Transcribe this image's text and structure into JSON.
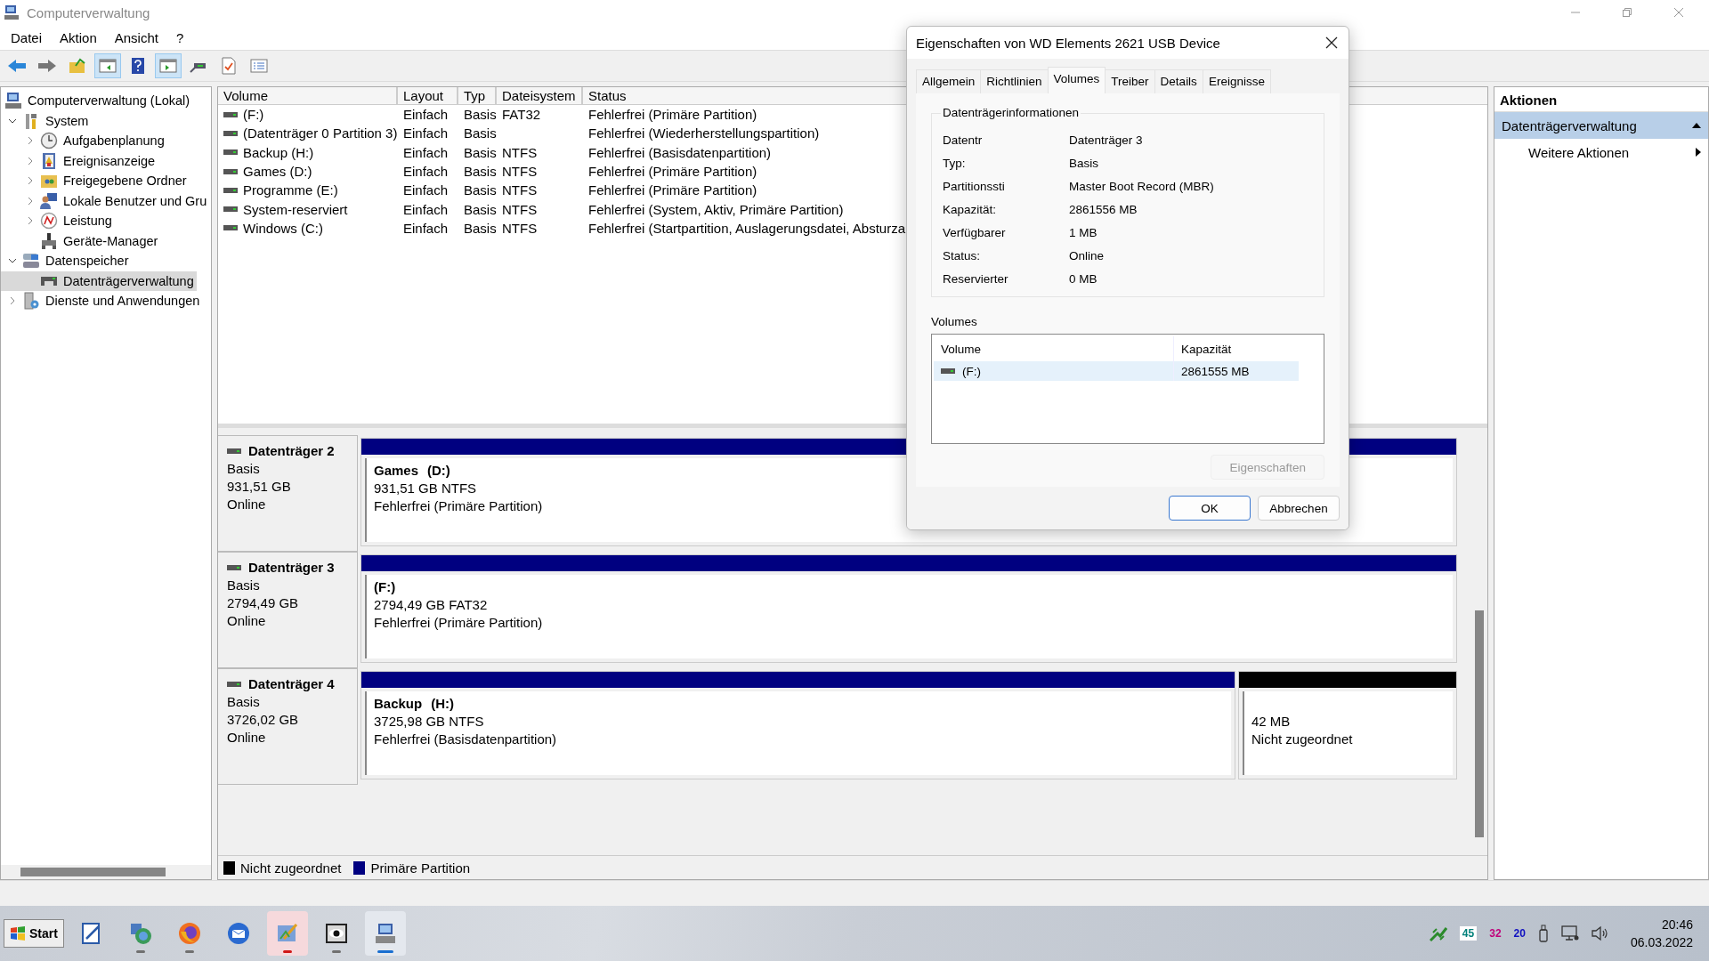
{
  "window": {
    "title": "Computerverwaltung"
  },
  "menu": [
    "Datei",
    "Aktion",
    "Ansicht",
    "?"
  ],
  "toolbar": [
    {
      "kind": "back",
      "pressed": false
    },
    {
      "kind": "forward",
      "pressed": false
    },
    {
      "kind": "up",
      "pressed": false
    },
    {
      "kind": "tree-pane",
      "pressed": true
    },
    {
      "kind": "help",
      "pressed": false
    },
    {
      "kind": "action-pane",
      "pressed": true
    },
    {
      "kind": "connect",
      "pressed": false
    },
    {
      "kind": "check",
      "pressed": false
    },
    {
      "kind": "list",
      "pressed": false
    }
  ],
  "tree": [
    {
      "label": "Computerverwaltung (Lokal)",
      "kind": "computer",
      "selected": false,
      "children": [
        {
          "label": "System",
          "kind": "tools",
          "expanded": true,
          "selected": false,
          "children": [
            {
              "label": "Aufgabenplanung",
              "kind": "clock",
              "expanded": false,
              "selected": false
            },
            {
              "label": "Ereignisanzeige",
              "kind": "log",
              "expanded": false,
              "selected": false
            },
            {
              "label": "Freigegebene Ordner",
              "kind": "share",
              "expanded": false,
              "selected": false
            },
            {
              "label": "Lokale Benutzer und Gru",
              "kind": "users",
              "expanded": false,
              "selected": false
            },
            {
              "label": "Leistung",
              "kind": "perf",
              "expanded": false,
              "selected": false
            },
            {
              "label": "Geräte-Manager",
              "kind": "device",
              "selected": false
            }
          ]
        },
        {
          "label": "Datenspeicher",
          "kind": "storage",
          "expanded": true,
          "selected": false,
          "children": [
            {
              "label": "Datenträgerverwaltung",
              "kind": "disk",
              "selected": true
            }
          ]
        },
        {
          "label": "Dienste und Anwendungen",
          "kind": "services",
          "expanded": false,
          "selected": false
        }
      ]
    }
  ],
  "table": {
    "columns": [
      "Volume",
      "Layout",
      "Typ",
      "Dateisystem",
      "Status"
    ],
    "rows": [
      {
        "volume": "(F:)",
        "layout": "Einfach",
        "type": "Basis",
        "filesystem": "FAT32",
        "status": "Fehlerfrei (Primäre Partition)"
      },
      {
        "volume": "(Datenträger 0 Partition 3)",
        "layout": "Einfach",
        "type": "Basis",
        "status": "Fehlerfrei (Wiederherstellungspartition)"
      },
      {
        "volume": "Backup (H:)",
        "layout": "Einfach",
        "type": "Basis",
        "filesystem": "NTFS",
        "status": "Fehlerfrei (Basisdatenpartition)"
      },
      {
        "volume": "Games (D:)",
        "layout": "Einfach",
        "type": "Basis",
        "filesystem": "NTFS",
        "status": "Fehlerfrei (Primäre Partition)"
      },
      {
        "volume": "Programme (E:)",
        "layout": "Einfach",
        "type": "Basis",
        "filesystem": "NTFS",
        "status": "Fehlerfrei (Primäre Partition)"
      },
      {
        "volume": "System-reserviert",
        "layout": "Einfach",
        "type": "Basis",
        "filesystem": "NTFS",
        "status": "Fehlerfrei (System, Aktiv, Primäre Partition)"
      },
      {
        "volume": "Windows (C:)",
        "layout": "Einfach",
        "type": "Basis",
        "filesystem": "NTFS",
        "status": "Fehlerfrei (Startpartition, Auslagerungsdatei, Absturza"
      }
    ]
  },
  "disks": [
    {
      "name": "Datenträger 2",
      "type": "Basis",
      "size": "931,51 GB",
      "state": "Online",
      "partitions": [
        {
          "kind": "primary",
          "label": "Games",
          "letter": "(D:)",
          "info": "931,51 GB NTFS",
          "status": "Fehlerfrei (Primäre Partition)"
        }
      ]
    },
    {
      "name": "Datenträger 3",
      "type": "Basis",
      "size": "2794,49 GB",
      "state": "Online",
      "partitions": [
        {
          "kind": "primary",
          "letter": "(F:)",
          "info": "2794,49 GB FAT32",
          "status": "Fehlerfrei (Primäre Partition)"
        }
      ]
    },
    {
      "name": "Datenträger 4",
      "type": "Basis",
      "size": "3726,02 GB",
      "state": "Online",
      "partitions": [
        {
          "kind": "primary",
          "label": "Backup",
          "letter": "(H:)",
          "info": "3725,98 GB NTFS",
          "status": "Fehlerfrei (Basisdatenpartition)"
        },
        {
          "kind": "unallocated",
          "info": "42 MB",
          "status": "Nicht zugeordnet"
        }
      ]
    }
  ],
  "legend": [
    {
      "label": "Nicht zugeordnet",
      "color": "#000000"
    },
    {
      "label": "Primäre Partition",
      "color": "#000080"
    }
  ],
  "actions": {
    "title": "Aktionen",
    "sections": [
      {
        "label": "Datenträgerverwaltung",
        "expanded": true,
        "items": [
          "Weitere Aktionen"
        ]
      }
    ]
  },
  "dialog": {
    "title": "Eigenschaften von WD Elements 2621 USB Device",
    "tabs": [
      {
        "label": "Allgemein",
        "selected": false
      },
      {
        "label": "Richtlinien",
        "selected": false
      },
      {
        "label": "Volumes",
        "selected": true
      },
      {
        "label": "Treiber",
        "selected": false
      },
      {
        "label": "Details",
        "selected": false
      },
      {
        "label": "Ereignisse",
        "selected": false
      }
    ],
    "group": {
      "title": "Datenträgerinformationen",
      "rows": [
        {
          "label": "Datentr",
          "value": "Datenträger 3"
        },
        {
          "label": "Typ:",
          "value": "Basis"
        },
        {
          "label": "Partitionssti",
          "value": "Master Boot Record (MBR)"
        },
        {
          "label": "Kapazität:",
          "value": "2861556 MB"
        },
        {
          "label": "Verfügbarer",
          "value": "1 MB"
        },
        {
          "label": "Status:",
          "value": "Online"
        },
        {
          "label": "Reservierter",
          "value": "0 MB"
        }
      ]
    },
    "volumes": {
      "title": "Volumes",
      "columns": [
        "Volume",
        "Kapazität"
      ],
      "rows": [
        {
          "volume": "(F:)",
          "capacity": "2861555 MB",
          "selected": true
        }
      ]
    },
    "properties_button": {
      "label": "Eigenschaften",
      "disabled": true
    },
    "buttons": [
      {
        "label": "OK",
        "default": true
      },
      {
        "label": "Abbrechen",
        "default": false
      }
    ]
  },
  "taskbar": {
    "start": "Start",
    "apps": [
      {
        "kind": "notes",
        "active": false,
        "attention": false
      },
      {
        "kind": "globe",
        "active": false,
        "attention": false,
        "color": "#707070"
      },
      {
        "kind": "firefox",
        "active": false,
        "attention": false,
        "color": "#707070"
      },
      {
        "kind": "mail",
        "active": false,
        "attention": false
      },
      {
        "kind": "paint",
        "active": false,
        "attention": true,
        "color": "#d01818"
      },
      {
        "kind": "eye",
        "active": false,
        "attention": false,
        "color": "#707070"
      },
      {
        "kind": "computer",
        "active": true,
        "attention": false,
        "color": "#1a6fd0"
      }
    ],
    "counters": [
      {
        "text": "45",
        "color": "#00807a"
      },
      {
        "text": "32",
        "color": "#c0007a"
      },
      {
        "text": "20",
        "color": "#1010c0"
      }
    ],
    "time": "20:46",
    "date": "06.03.2022"
  }
}
